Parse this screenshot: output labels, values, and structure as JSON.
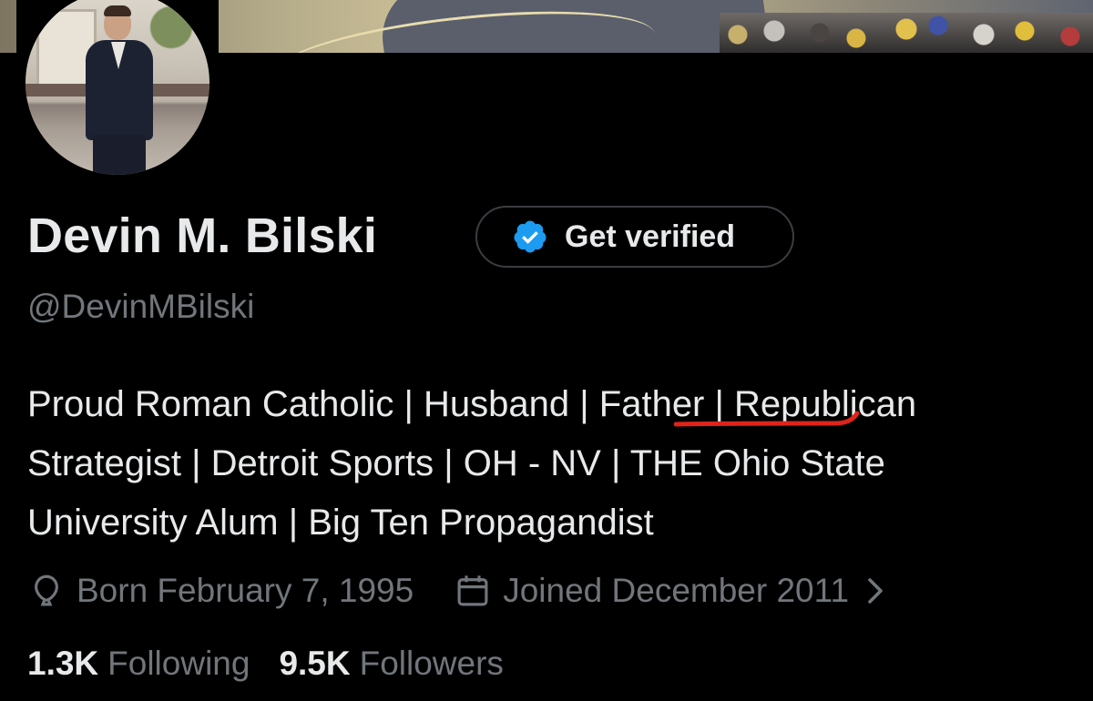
{
  "profile": {
    "display_name": "Devin M. Bilski",
    "handle": "@DevinMBilski",
    "verify_button_label": "Get verified",
    "bio_lines": [
      "Proud Roman Catholic | Husband | Father | Republican",
      "Strategist | Detroit Sports | OH - NV | THE Ohio State",
      "University Alum | Big Ten Propagandist"
    ],
    "highlight_annotation": {
      "text": "| Father |",
      "color": "#e0241b"
    },
    "born": "Born February 7, 1995",
    "joined": "Joined December 2011",
    "following_count": "1.3K",
    "following_label": "Following",
    "followers_count": "9.5K",
    "followers_label": "Followers"
  },
  "icons": {
    "verify": "verified-badge-icon",
    "born": "balloon-icon",
    "joined": "calendar-icon",
    "more": "chevron-right-icon"
  },
  "colors": {
    "background": "#000000",
    "primary_text": "#e7e9ea",
    "secondary_text": "#71767b",
    "verified_blue": "#1d9bf0",
    "annotation_red": "#e0241b"
  }
}
